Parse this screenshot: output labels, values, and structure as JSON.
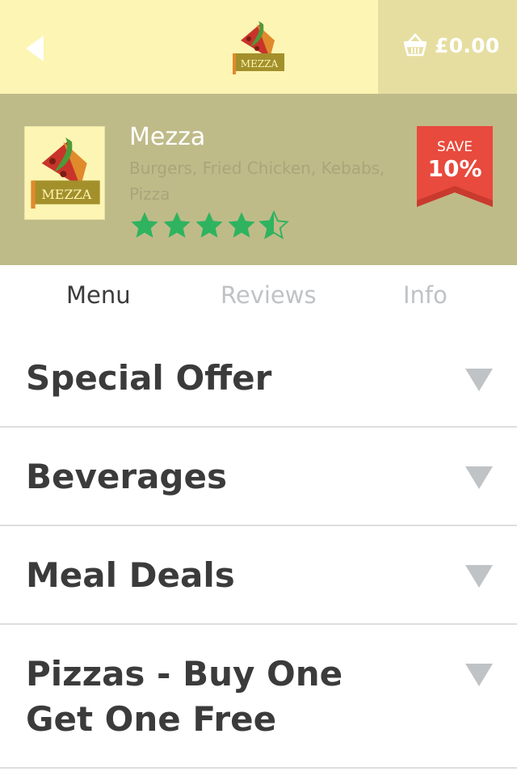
{
  "header": {
    "back_icon": "back-arrow-icon",
    "logo_icon": "mezza-logo-icon",
    "basket_icon": "basket-icon",
    "cart_total": "£0.00",
    "colors": {
      "background": "#fdf5b3",
      "cart_background": "#e6dea1"
    }
  },
  "restaurant": {
    "name": "Mezza",
    "cuisine": "Burgers, Fried Chicken, Kebabs, Pizza",
    "rating": 4.5,
    "rating_max": 5,
    "star_color": "#2fb35f",
    "hero_background": "#bfbb89",
    "logo_text": "MEZZA"
  },
  "badge": {
    "label": "SAVE",
    "value": "10%",
    "color": "#e84a3d"
  },
  "tabs": [
    {
      "label": "Menu",
      "active": true
    },
    {
      "label": "Reviews",
      "active": false
    },
    {
      "label": "Info",
      "active": false
    }
  ],
  "sections": [
    {
      "title_line1": "Special Offer",
      "title_line2": ""
    },
    {
      "title_line1": "Beverages",
      "title_line2": ""
    },
    {
      "title_line1": "Meal Deals",
      "title_line2": ""
    },
    {
      "title_line1": "Pizzas - Buy One",
      "title_line2": "Get One Free"
    }
  ],
  "section_chevron_icon": "chevron-down-icon"
}
